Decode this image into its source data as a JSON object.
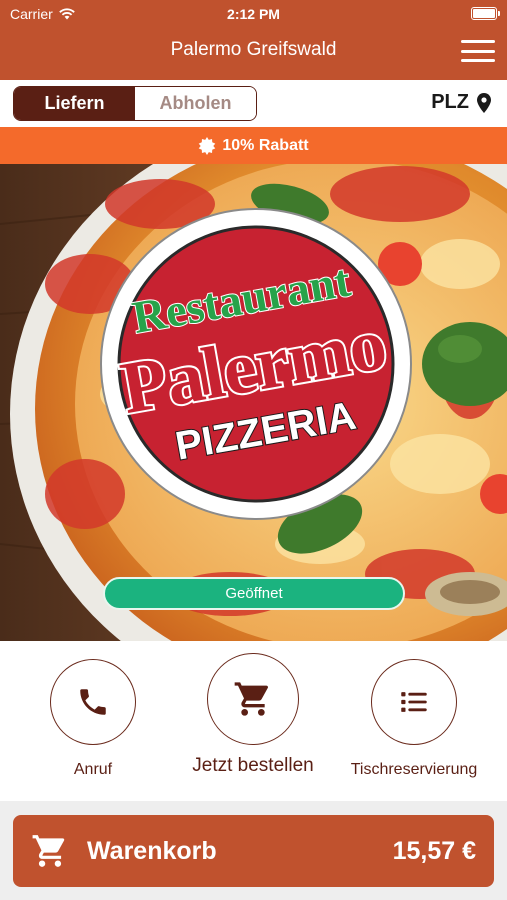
{
  "status": {
    "carrier": "Carrier",
    "time": "2:12 PM"
  },
  "nav": {
    "title": "Palermo Greifswald",
    "menu_icon": "hamburger-menu-icon"
  },
  "mode": {
    "deliver": "Liefern",
    "pickup": "Abholen",
    "selected": "Liefern",
    "plz": "PLZ"
  },
  "banner": {
    "text": "10% Rabatt"
  },
  "hero": {
    "logo": {
      "line1": "Restaurant",
      "line2": "Palermo",
      "line3": "PIZZERIA"
    },
    "status": "Geöffnet"
  },
  "actions": [
    {
      "label": "Anruf",
      "icon": "phone-icon"
    },
    {
      "label": "Jetzt bestellen",
      "icon": "cart-icon"
    },
    {
      "label": "Tischreservierung",
      "icon": "list-icon"
    }
  ],
  "cart": {
    "label": "Warenkorb",
    "total": "15,57 €"
  },
  "colors": {
    "brand": "#c0522e",
    "accent_orange": "#f46a2b",
    "dark_brown": "#5a1f14",
    "open_green": "#1bb37f"
  }
}
